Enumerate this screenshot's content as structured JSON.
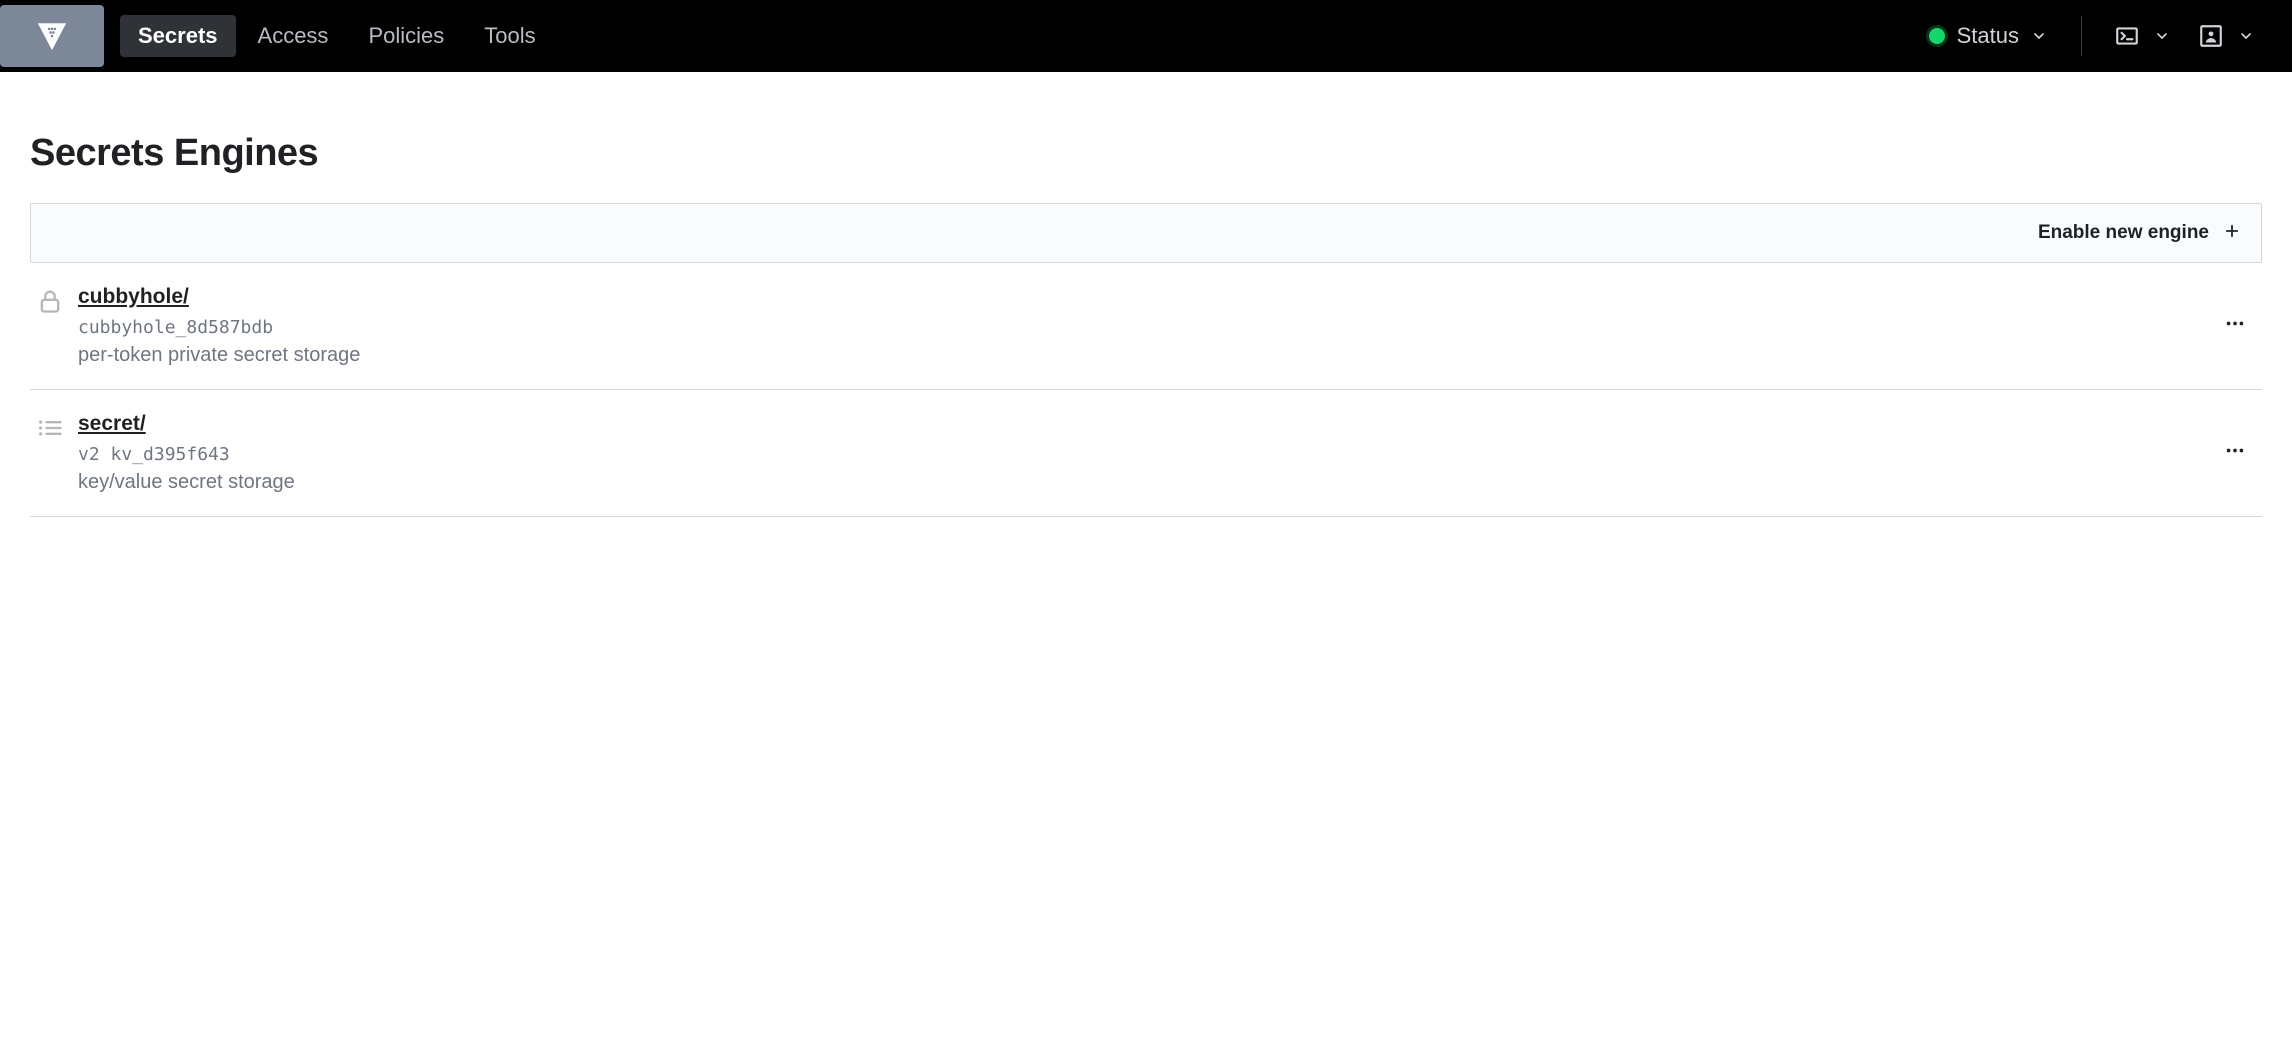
{
  "nav": {
    "items": [
      {
        "label": "Secrets",
        "active": true
      },
      {
        "label": "Access",
        "active": false
      },
      {
        "label": "Policies",
        "active": false
      },
      {
        "label": "Tools",
        "active": false
      }
    ],
    "status_label": "Status"
  },
  "page": {
    "title": "Secrets Engines",
    "enable_label": "Enable new engine"
  },
  "engines": [
    {
      "icon": "lock",
      "name": "cubbyhole/",
      "accessor": "cubbyhole_8d587bdb",
      "description": "per-token private secret storage"
    },
    {
      "icon": "list",
      "name": "secret/",
      "accessor": "v2 kv_d395f643",
      "description": "key/value secret storage"
    }
  ]
}
